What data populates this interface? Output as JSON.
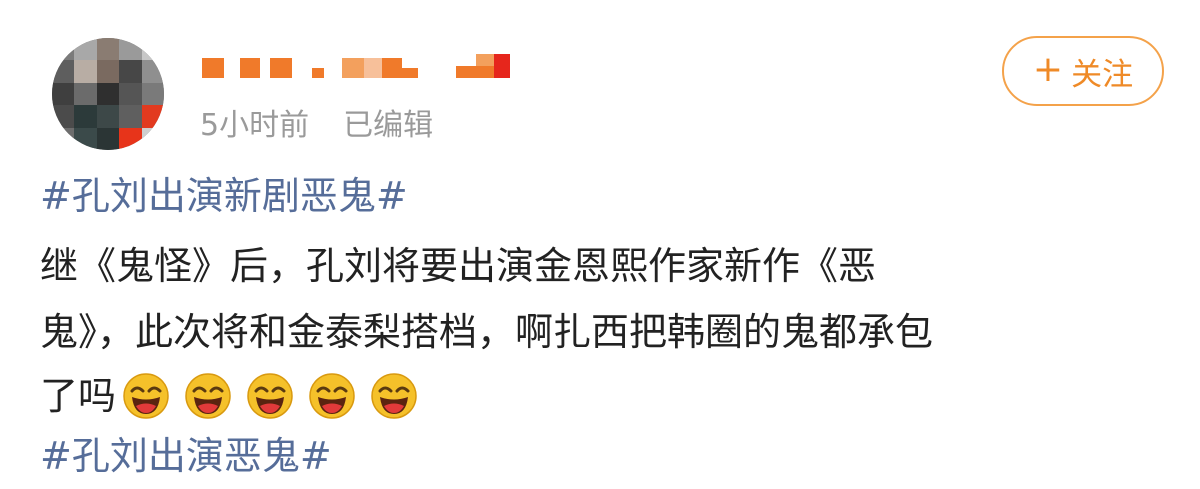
{
  "post": {
    "time": "5小时前",
    "edited": "已编辑",
    "follow_label": "关注",
    "follow_icon": "plus-icon",
    "hashtag_top": "#孔刘出演新剧恶鬼#",
    "body_line1": "继《鬼怪》后，孔刘将要出演金恩熙作家新作《恶",
    "body_line2": "鬼》，此次将和金泰梨搭档，啊扎西把韩圈的鬼都承包",
    "body_line3": "了吗",
    "emoji_name": "laughing-face-icon",
    "emoji_count": 5,
    "hashtag_bottom": "#孔刘出演恶鬼#"
  },
  "colors": {
    "hashtag": "#566d99",
    "follow": "#ef8a27",
    "meta": "#9a9a9a",
    "text": "#222222",
    "emoji": "#f5c12a"
  }
}
